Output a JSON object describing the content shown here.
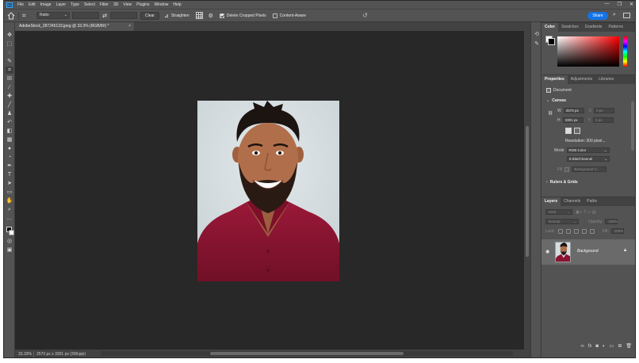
{
  "app": {
    "logo_text": "Ps"
  },
  "menu": [
    "File",
    "Edit",
    "Image",
    "Layer",
    "Type",
    "Select",
    "Filter",
    "3D",
    "View",
    "Plugins",
    "Window",
    "Help"
  ],
  "window_controls": {
    "minimize": "—",
    "maximize": "❐",
    "close": "✕"
  },
  "options_bar": {
    "ratio_value": "Ratio",
    "clear_label": "Clear",
    "straighten_label": "Straighten",
    "delete_cropped_label": "Delete Cropped Pixels",
    "delete_cropped_checked": true,
    "content_aware_label": "Content-Aware",
    "content_aware_checked": false,
    "share_label": "Share"
  },
  "document": {
    "tab_title": "AdobeStock_287245133.jpeg @ 33.3% (RGB/8#) *",
    "zoom": "33.33%",
    "status_info": "2570 px x 3301 px (300 ppi)"
  },
  "color_panel": {
    "tabs": [
      "Color",
      "Swatches",
      "Gradients",
      "Patterns"
    ],
    "active_tab": "Color",
    "hue_color": "#ff0000"
  },
  "properties_panel": {
    "tabs": [
      "Properties",
      "Adjustments",
      "Libraries"
    ],
    "document_label": "Document",
    "canvas_header": "Canvas",
    "w_label": "W",
    "w_value": "2570 px",
    "h_label": "H",
    "h_value": "3301 px",
    "x_label": "X",
    "x_value": "0 px",
    "y_label": "Y",
    "y_value": "0 px",
    "resolution": "Resolution: 300 pixel...",
    "mode_label": "Mode",
    "mode_value": "RGB Color",
    "bits_value": "8 Bits/Channel",
    "fill_label": "Fill",
    "fill_value": "Background C...",
    "rulers_header": "Rulers & Grids"
  },
  "layers_panel": {
    "tabs": [
      "Layers",
      "Channels",
      "Paths"
    ],
    "filter_value": "Kind",
    "blend_value": "Normal",
    "opacity_label": "Opacity:",
    "opacity_value": "100%",
    "lock_label": "Lock:",
    "fill_label": "Fill:",
    "fill_value": "100%",
    "layer_name": "Background",
    "footer_icons": [
      "link-icon",
      "fx-icon",
      "mask-icon",
      "adjustment-icon",
      "folder-icon",
      "new-layer-icon",
      "trash-icon"
    ]
  },
  "colors": {
    "accent": "#1473e6",
    "canvas_bg": "#282828",
    "ui_bg": "#535353",
    "shirt": "#8b1230"
  }
}
